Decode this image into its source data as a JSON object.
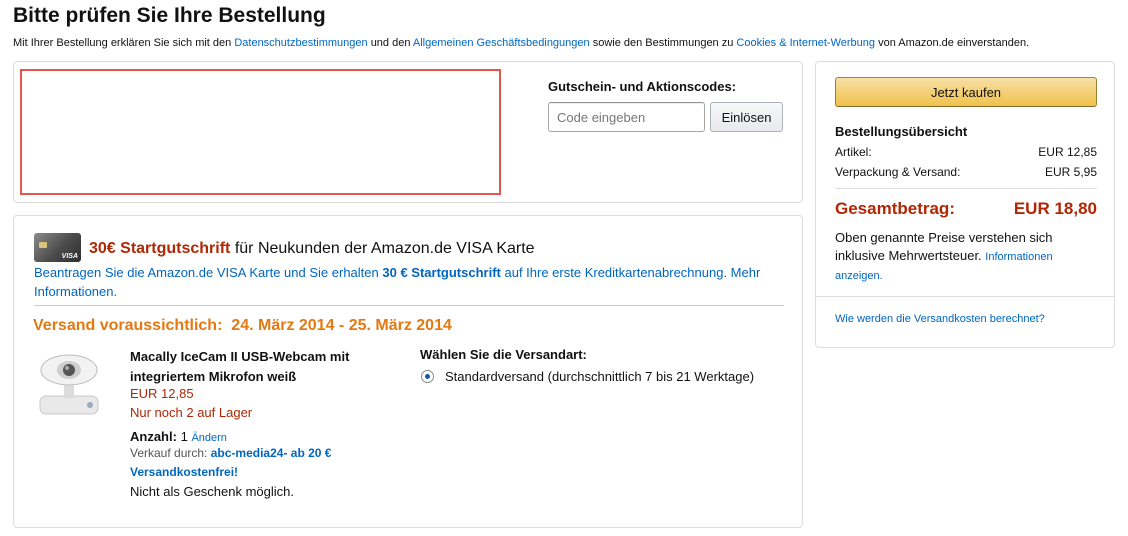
{
  "page": {
    "title": "Bitte prüfen Sie Ihre Bestellung",
    "legal": {
      "prefix": "Mit Ihrer Bestellung erklären Sie sich mit den",
      "privacy_link": "Datenschutzbestimmungen",
      "and": "und den",
      "terms_link": "Allgemeinen Geschäftsbedingungen",
      "middle": "sowie den Bestimmungen zu",
      "cookies_link": "Cookies & Internet-Werbung",
      "suffix": "von Amazon.de einverstanden."
    }
  },
  "promo": {
    "label": "Gutschein- und Aktionscodes:",
    "placeholder": "Code eingeben",
    "redeem_button": "Einlösen"
  },
  "visa": {
    "icon": "visa-card-icon",
    "highlight": "30€ Startgutschrift",
    "headline_rest": "für Neukunden der Amazon.de VISA Karte",
    "text_before": "Beantragen Sie die Amazon.de VISA Karte und Sie erhalten",
    "text_bold": "30 € Startgutschrift",
    "text_after": "auf Ihre erste Kreditkartenabrechnung. Mehr Informationen."
  },
  "shipment": {
    "estimate": "Versand voraussichtlich:  24. März 2014 - 25. März 2014",
    "product": {
      "image": "webcam-image",
      "name": "Macally IceCam II USB-Webcam mit integriertem Mikrofon weiß",
      "price": "EUR 12,85",
      "stock": "Nur noch 2 auf Lager",
      "quantity_label": "Anzahl:",
      "quantity": "1",
      "change_link": "Ändern",
      "seller_label": "Verkauf durch:",
      "seller": "abc-media24- ab 20 €",
      "free_shipping": "Versandkostenfrei!",
      "gift_note": "Nicht als Geschenk möglich."
    },
    "shipping_method": {
      "label": "Wählen Sie die Versandart:",
      "option": "Standardversand (durchschnittlich 7 bis 21 Werktage)",
      "selected": true
    }
  },
  "summary": {
    "buy_button": "Jetzt kaufen",
    "title": "Bestellungsübersicht",
    "items_label": "Artikel:",
    "items_value": "EUR 12,85",
    "shipping_label": "Verpackung & Versand:",
    "shipping_value": "EUR 5,95",
    "total_label": "Gesamtbetrag:",
    "total_value": "EUR 18,80",
    "tax_note": "Oben genannte Preise verstehen sich inklusive Mehrwertsteuer.",
    "tax_link": "Informationen anzeigen.",
    "shipping_cost_link": "Wie werden die Versandkosten berechnet?"
  },
  "colors": {
    "link": "#0066c0",
    "price": "#b12704",
    "shipping_date": "#e47911",
    "buy_button": "#f0c14b",
    "redaction_border": "#e3574e"
  }
}
